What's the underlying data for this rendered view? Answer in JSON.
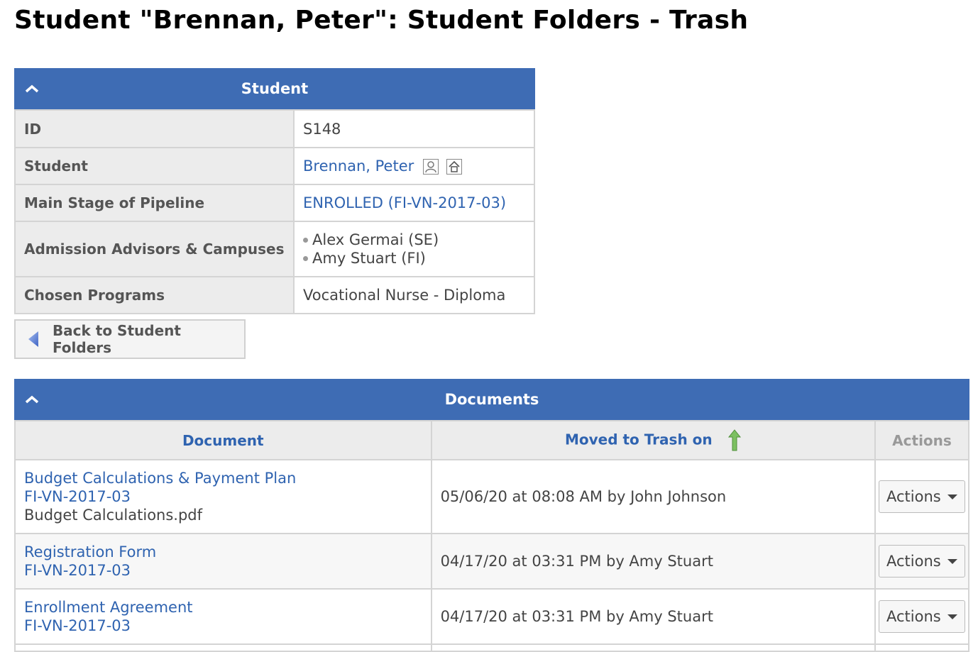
{
  "page": {
    "title": "Student \"Brennan, Peter\": Student Folders - Trash"
  },
  "student_panel": {
    "header": "Student",
    "rows": {
      "id": {
        "label": "ID",
        "value": "S148"
      },
      "student": {
        "label": "Student",
        "value": "Brennan, Peter"
      },
      "stage": {
        "label": "Main Stage of Pipeline",
        "value": "ENROLLED (FI-VN-2017-03)"
      },
      "advisors": {
        "label": "Admission Advisors & Campuses",
        "items": [
          "Alex Germai (SE)",
          "Amy Stuart (FI)"
        ]
      },
      "programs": {
        "label": "Chosen Programs",
        "value": "Vocational Nurse - Diploma"
      }
    }
  },
  "back_button": {
    "label": "Back to Student Folders"
  },
  "documents_panel": {
    "header": "Documents",
    "columns": {
      "document": "Document",
      "moved": "Moved to Trash on",
      "actions": "Actions"
    },
    "rows": [
      {
        "title": "Budget Calculations & Payment Plan",
        "code": "FI-VN-2017-03",
        "file": "Budget Calculations.pdf",
        "moved": "05/06/20 at 08:08 AM by John Johnson",
        "action_label": "Actions"
      },
      {
        "title": "Registration Form",
        "code": "FI-VN-2017-03",
        "moved": "04/17/20 at 03:31 PM by Amy Stuart",
        "action_label": "Actions"
      },
      {
        "title": "Enrollment Agreement",
        "code": "FI-VN-2017-03",
        "moved": "04/17/20 at 03:31 PM by Amy Stuart",
        "action_label": "Actions"
      }
    ]
  },
  "colors": {
    "header_blue": "#3e6cb4",
    "link_blue": "#2f63b0",
    "sort_arrow_green": "#6ab04c"
  }
}
